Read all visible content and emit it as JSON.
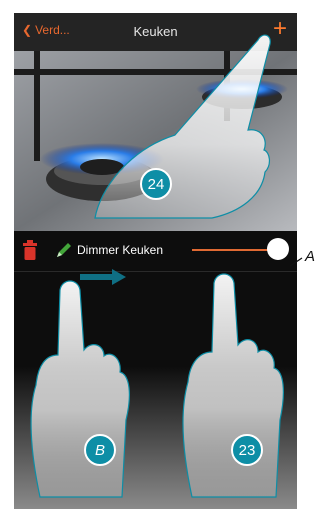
{
  "navbar": {
    "back_label": "Verd...",
    "title": "Keuken",
    "add_symbol": "+"
  },
  "device_row": {
    "label": "Dimmer Keuken",
    "slider_level_fraction": 1.0
  },
  "badges": {
    "top": "24",
    "bottom_left": "B",
    "bottom_right": "23"
  },
  "callout": {
    "label": "A"
  },
  "icons": [
    "chevron-left-icon",
    "plus-icon",
    "trash-icon",
    "pencil-icon",
    "arrow-right-icon"
  ],
  "colors": {
    "accent_orange": "#ff7a2e",
    "badge_teal": "#0e8ea6",
    "trash_red": "#d9342a",
    "pencil_green": "#43a63a"
  }
}
